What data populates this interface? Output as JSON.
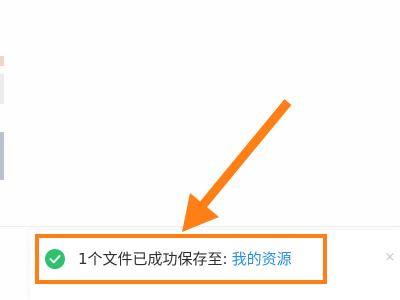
{
  "toast": {
    "message_prefix": "1个文件已成功保存至:",
    "link_label": "我的资源",
    "close_glyph": "×",
    "status_icon": "check-circle-icon"
  },
  "colors": {
    "success": "#2dc26b",
    "highlight": "#ff7f17",
    "link": "#2a8ee0"
  }
}
